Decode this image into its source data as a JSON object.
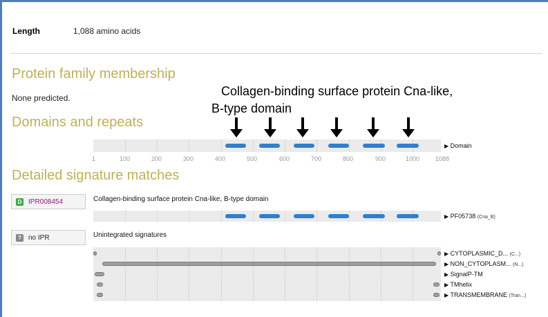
{
  "length": {
    "label": "Length",
    "value": "1,088 amino acids"
  },
  "sections": {
    "family": "Protein family membership",
    "family_note": "None predicted.",
    "domains": "Domains and repeats",
    "matches": "Detailed signature matches"
  },
  "annotation": {
    "line1": "Collagen-binding surface protein Cna-like,",
    "line2": "B-type domain"
  },
  "axis": {
    "ticks": [
      "1",
      "100",
      "200",
      "300",
      "400",
      "500",
      "600",
      "700",
      "800",
      "900",
      "1000",
      "1088"
    ]
  },
  "domain_track_label": "Domain",
  "ipr_entry": {
    "badge_letter": "D",
    "accession": "IPR008454",
    "description": "Collagen-binding surface protein Cna-like, B-type domain",
    "signature_label": "PF05738",
    "signature_short": "(Cna_B)",
    "color": "#2f80cd"
  },
  "unintegrated": {
    "badge_letter": "?",
    "label": "no IPR",
    "description": "Unintegrated signatures",
    "rows": [
      {
        "label": "CYTOPLASMIC_D...",
        "short": "(C...)"
      },
      {
        "label": "NON_CYTOPLASM...",
        "short": "(N...)"
      },
      {
        "label": "SignalP-TM",
        "short": ""
      },
      {
        "label": "TMhelix",
        "short": ""
      },
      {
        "label": "TRANSMEMBRANE",
        "short": "(Tran...)"
      }
    ]
  },
  "domain_ranges": [
    [
      420,
      480
    ],
    [
      530,
      590
    ],
    [
      635,
      695
    ],
    [
      745,
      805
    ],
    [
      860,
      920
    ],
    [
      965,
      1035
    ]
  ],
  "colors": {
    "section_title": "#bdb05a",
    "domain_blue": "#2f80cd",
    "unintegrated_gray": "#9e9e9e",
    "frame_blue": "#4b7fc0",
    "ipr_link": "#8e1a7b"
  }
}
